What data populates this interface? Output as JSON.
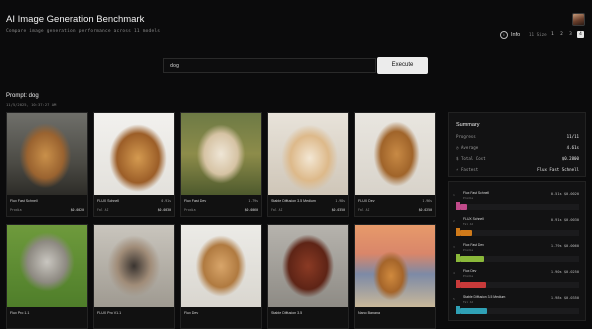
{
  "header": {
    "title": "AI Image Generation Benchmark",
    "subtitle": "Compare image generation performance across 11 models",
    "info_label": "Info",
    "size_label": "11 Size",
    "pages": [
      "1",
      "2",
      "3",
      "4"
    ]
  },
  "prompt_bar": {
    "value": "dog",
    "button": "Execute"
  },
  "prompt_section": {
    "label": "Prompt: dog",
    "timestamp": "11/5/2025, 10:37:27 AM"
  },
  "cards": [
    {
      "model": "Flux Fast Schnell",
      "provider": "Prodia",
      "time": "",
      "cost": "$0.0020"
    },
    {
      "model": "FLUX Schnell",
      "provider": "Fal AI",
      "time": "0.91s",
      "cost": "$0.0030"
    },
    {
      "model": "Flux Fast Dev",
      "provider": "Prodia",
      "time": "1.79s",
      "cost": "$0.0060"
    },
    {
      "model": "Stable Diffusion 3.5 Medium",
      "provider": "Fal AI",
      "time": "1.98s",
      "cost": "$0.0350"
    },
    {
      "model": "FLUX Dev",
      "provider": "Fal AI",
      "time": "1.96s",
      "cost": "$0.0250"
    },
    {
      "model": "Flux Pro 1.1",
      "provider": "",
      "time": "",
      "cost": ""
    },
    {
      "model": "FLUX Pro V1.1",
      "provider": "",
      "time": "",
      "cost": ""
    },
    {
      "model": "Flux Dev",
      "provider": "",
      "time": "",
      "cost": ""
    },
    {
      "model": "Stable Diffusion 3.5",
      "provider": "",
      "time": "",
      "cost": ""
    },
    {
      "model": "Nano Banana",
      "provider": "",
      "time": "",
      "cost": ""
    }
  ],
  "summary": {
    "title": "Summary",
    "rows": [
      {
        "label": "Progress",
        "value": "11/11"
      },
      {
        "label": "Average",
        "value": "4.61s"
      },
      {
        "label": "Total Cost",
        "value": "$0.2800"
      },
      {
        "label": "Fastest",
        "value": "Flux Fast Schnell"
      }
    ]
  },
  "results": [
    {
      "rank": "1",
      "model": "Flux Fast Schnell",
      "provider": "Prodia",
      "time": "0.51s",
      "cost": "$0.0020",
      "color": "#c04a8a",
      "fraction": 0.06
    },
    {
      "rank": "2",
      "model": "FLUX Schnell",
      "provider": "Fal AI",
      "time": "0.91s",
      "cost": "$0.0030",
      "color": "#d07a1a",
      "fraction": 0.1
    },
    {
      "rank": "3",
      "model": "Flux Fast Dev",
      "provider": "Prodia",
      "time": "1.79s",
      "cost": "$0.0060",
      "color": "#8ab83a",
      "fraction": 0.2
    },
    {
      "rank": "4",
      "model": "Flux Dev",
      "provider": "Prodia",
      "time": "1.90s",
      "cost": "$0.0250",
      "color": "#c83a3a",
      "fraction": 0.22
    },
    {
      "rank": "5",
      "model": "Stable Diffusion 3.5 Medium",
      "provider": "Fal AI",
      "time": "1.98s",
      "cost": "$0.0350",
      "color": "#2fa0b5",
      "fraction": 0.23
    }
  ],
  "colors": {
    "accent": "#ececec",
    "background": "#0b0b0c",
    "panel": "#121213"
  }
}
